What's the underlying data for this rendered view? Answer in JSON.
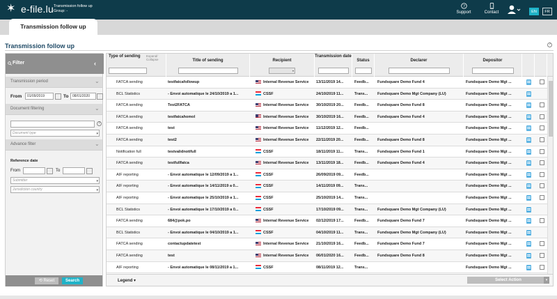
{
  "header": {
    "logo": "e-file.lu",
    "app_title": "Transmission follow up",
    "app_group": "Group: -",
    "support_label": "Support",
    "contact_label": "Contact",
    "lang_en": "EN",
    "lang_fr": "FR"
  },
  "tab": {
    "label": "Transmission follow up"
  },
  "page": {
    "title": "Transmission follow up",
    "help": "?"
  },
  "filter": {
    "title": "Filter",
    "transmission_period": "Transmission period",
    "from_label": "From",
    "from_value": "01/09/2019",
    "to_label": "To",
    "to_value": "08/01/2020",
    "document_filtering": "Document filtering",
    "document_search_value": "",
    "document_type_placeholder": "Document type",
    "advance_filter": "Advance filter",
    "reference_date": "Reference date",
    "ref_from_label": "From",
    "ref_to_label": "To",
    "submitter_placeholder": "Submitter",
    "jurisdiction_placeholder": "Jurisdiction country",
    "reset_label": "Reset",
    "search_label": "Search"
  },
  "grid": {
    "columns": {
      "type": "Type of sending",
      "expand": "Expand/ Collapse",
      "title": "Title of sending",
      "recipient": "Recipient",
      "date": "Transmission date",
      "status": "Status",
      "declarer": "Declarer",
      "depositor": "Depositor"
    },
    "rows": [
      {
        "type": "FATCA sending",
        "title": "testfatcafollowup",
        "flag": "us",
        "recipient": "Internal Revenue Service",
        "date": "13/11/2019 14...",
        "status": "Feedb...",
        "declarer": "Fundsquare Demo Fund 4",
        "depositor": "Fundsquare Demo Mgt ...",
        "check": true
      },
      {
        "type": "BCL Statistics",
        "title": "- Envoi automatique le 24/10/2019 a 1...",
        "flag": "lu",
        "recipient": "CSSF",
        "date": "24/10/2019 11...",
        "status": "Trans...",
        "declarer": "Fundsquare Demo Mgt Company (LU)",
        "depositor": "Fundsquare Demo Mgt ...",
        "check": false
      },
      {
        "type": "FATCA sending",
        "title": "Test2FATCA",
        "flag": "us",
        "recipient": "Internal Revenue Service",
        "date": "30/10/2019 20...",
        "status": "Feedb...",
        "declarer": "Fundsquare Demo Fund 8",
        "depositor": "Fundsquare Demo Mgt ...",
        "check": true
      },
      {
        "type": "FATCA sending",
        "title": "testfatcahomol",
        "flag": "us",
        "recipient": "Internal Revenue Service",
        "date": "30/10/2019 16...",
        "status": "Feedb...",
        "declarer": "Fundsquare Demo Fund 4",
        "depositor": "Fundsquare Demo Mgt ...",
        "check": true
      },
      {
        "type": "FATCA sending",
        "title": "test",
        "flag": "us",
        "recipient": "Internal Revenue Service",
        "date": "11/12/2019 12...",
        "status": "Feedb...",
        "declarer": "",
        "depositor": "Fundsquare Demo Mgt ...",
        "check": true
      },
      {
        "type": "FATCA sending",
        "title": "test2",
        "flag": "us",
        "recipient": "Internal Revenue Service",
        "date": "22/11/2019 20...",
        "status": "Feedb...",
        "declarer": "Fundsquare Demo Fund 8",
        "depositor": "Fundsquare Demo Mgt ...",
        "check": true
      },
      {
        "type": "Notification full",
        "title": "testvalidnotifull",
        "flag": "lu",
        "recipient": "CSSF",
        "date": "18/11/2019 11...",
        "status": "Trans...",
        "declarer": "Fundsquare Demo Fund 1",
        "depositor": "Fundsquare Demo Mgt ...",
        "check": true
      },
      {
        "type": "FATCA sending",
        "title": "testfullfatca",
        "flag": "us",
        "recipient": "Internal Revenue Service",
        "date": "13/11/2019 18...",
        "status": "Feedb...",
        "declarer": "Fundsquare Demo Fund 4",
        "depositor": "Fundsquare Demo Mgt ...",
        "check": true
      },
      {
        "type": "AIF reporting",
        "title": "- Envoi automatique le 12/09/2019 a 1...",
        "flag": "lu",
        "recipient": "CSSF",
        "date": "26/09/2019 09...",
        "status": "Feedb...",
        "declarer": "",
        "depositor": "Fundsquare Demo Mgt ...",
        "check": true
      },
      {
        "type": "AIF reporting",
        "title": "- Envoi automatique le 14/11/2019 a 0...",
        "flag": "lu",
        "recipient": "CSSF",
        "date": "14/11/2019 09...",
        "status": "Trans...",
        "declarer": "",
        "depositor": "Fundsquare Demo Mgt ...",
        "check": true
      },
      {
        "type": "AIF reporting",
        "title": "- Envoi automatique le 25/10/2019 a 1...",
        "flag": "lu",
        "recipient": "CSSF",
        "date": "25/10/2019 14...",
        "status": "Trans...",
        "declarer": "",
        "depositor": "Fundsquare Demo Mgt ...",
        "check": true
      },
      {
        "type": "BCL Statistics",
        "title": "- Envoi automatique le 17/10/2019 a 0...",
        "flag": "lu",
        "recipient": "CSSF",
        "date": "17/10/2019 09...",
        "status": "Trans...",
        "declarer": "Fundsquare Demo Mgt Company (LU)",
        "depositor": "Fundsquare Demo Mgt ...",
        "check": false
      },
      {
        "type": "FATCA sending",
        "title": "684@pok.po",
        "flag": "us",
        "recipient": "Internal Revenue Service",
        "date": "02/12/2019 17...",
        "status": "Feedb...",
        "declarer": "Fundsquare Demo Fund 7",
        "depositor": "Fundsquare Demo Mgt ...",
        "check": true
      },
      {
        "type": "BCL Statistics",
        "title": "- Envoi automatique le 04/10/2019 a 1...",
        "flag": "lu",
        "recipient": "CSSF",
        "date": "04/10/2019 11...",
        "status": "Trans...",
        "declarer": "Fundsquare Demo Mgt Company (LU)",
        "depositor": "Fundsquare Demo Mgt ...",
        "check": false
      },
      {
        "type": "FATCA sending",
        "title": "contactupdatetest",
        "flag": "us",
        "recipient": "Internal Revenue Service",
        "date": "21/10/2019 16...",
        "status": "Feedb...",
        "declarer": "Fundsquare Demo Fund 7",
        "depositor": "Fundsquare Demo Mgt ...",
        "check": true
      },
      {
        "type": "FATCA sending",
        "title": "test",
        "flag": "us",
        "recipient": "Internal Revenue Service",
        "date": "06/01/2020 16...",
        "status": "Feedb...",
        "declarer": "Fundsquare Demo Fund 8",
        "depositor": "Fundsquare Demo Mgt ...",
        "check": true
      },
      {
        "type": "AIF reporting",
        "title": "- Envoi automatique le 08/11/2019 a 1...",
        "flag": "lu",
        "recipient": "CSSF",
        "date": "08/11/2019 12...",
        "status": "Trans...",
        "declarer": "",
        "depositor": "Fundsquare Demo Mgt ...",
        "check": true
      }
    ],
    "legend_label": "Legend",
    "select_action_label": "Select Action"
  }
}
